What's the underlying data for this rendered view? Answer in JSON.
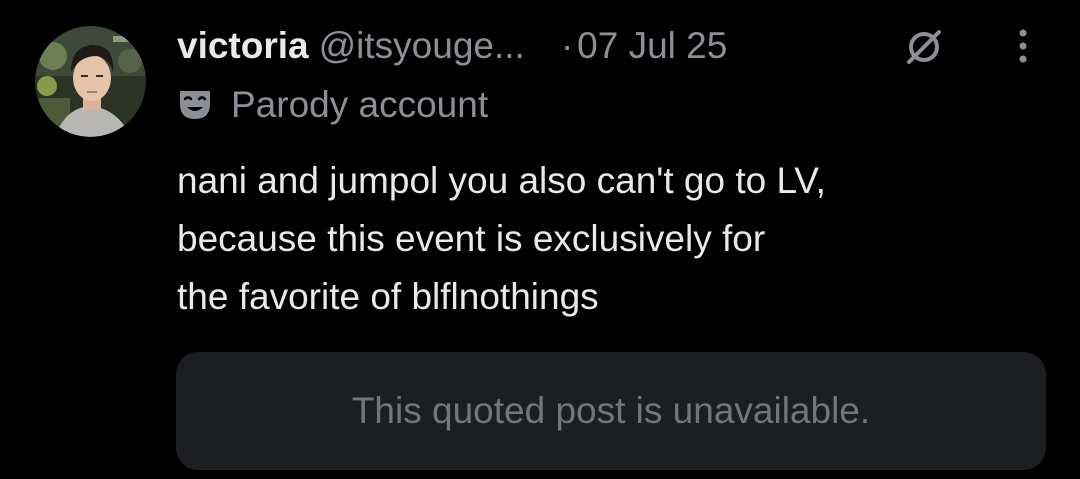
{
  "post": {
    "author": {
      "name": "victoria",
      "handle": "@itsyouge...",
      "label": "Parody account"
    },
    "separator": "·",
    "date": "07 Jul 25",
    "text_lines": [
      "nani and jumpol you also can't go to LV,",
      "because this event is exclusively for",
      "the favorite of blflnothings"
    ],
    "quoted_post": {
      "message": "This quoted post is unavailable."
    }
  },
  "icons": {
    "avatar": "avatar-photo",
    "replies_restricted": "no-reply-icon",
    "more": "more-options-icon",
    "parody": "theater-mask-icon"
  },
  "colors": {
    "background": "#000000",
    "primary_text": "#e7e9ea",
    "secondary_text": "#8b9096",
    "quote_background": "#1c1e21",
    "quote_text": "#71767b"
  }
}
